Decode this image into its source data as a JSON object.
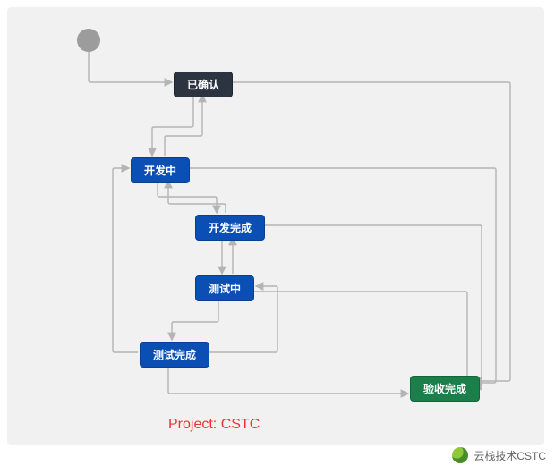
{
  "diagram": {
    "project_label": "Project: CSTC",
    "nodes": {
      "start": {
        "kind": "start"
      },
      "confirmed": {
        "label": "已确认",
        "kind": "dark"
      },
      "developing": {
        "label": "开发中",
        "kind": "blue"
      },
      "dev_done": {
        "label": "开发完成",
        "kind": "blue"
      },
      "testing": {
        "label": "测试中",
        "kind": "blue"
      },
      "test_done": {
        "label": "测试完成",
        "kind": "blue"
      },
      "accepted": {
        "label": "验收完成",
        "kind": "green"
      }
    },
    "edges": [
      {
        "from": "start",
        "to": "confirmed"
      },
      {
        "from": "confirmed",
        "to": "developing",
        "bidir": true
      },
      {
        "from": "developing",
        "to": "dev_done",
        "bidir": true
      },
      {
        "from": "dev_done",
        "to": "testing",
        "bidir": true
      },
      {
        "from": "testing",
        "to": "test_done"
      },
      {
        "from": "test_done",
        "to": "developing",
        "back": true
      },
      {
        "from": "test_done",
        "to": "testing",
        "back": true
      },
      {
        "from": "testing",
        "to": "accepted",
        "right": true
      },
      {
        "from": "test_done",
        "to": "accepted",
        "right": true
      },
      {
        "from": "dev_done",
        "to": "accepted",
        "right": true
      },
      {
        "from": "developing",
        "to": "accepted",
        "right": true
      },
      {
        "from": "confirmed",
        "to": "accepted",
        "right": true
      }
    ]
  },
  "footer": {
    "channel": "云栈技术CSTC"
  },
  "colors": {
    "dark": "#2b3440",
    "blue": "#0b4fb5",
    "green": "#1b7f4b",
    "arrow": "#b4b4b4",
    "label": "#e33"
  }
}
